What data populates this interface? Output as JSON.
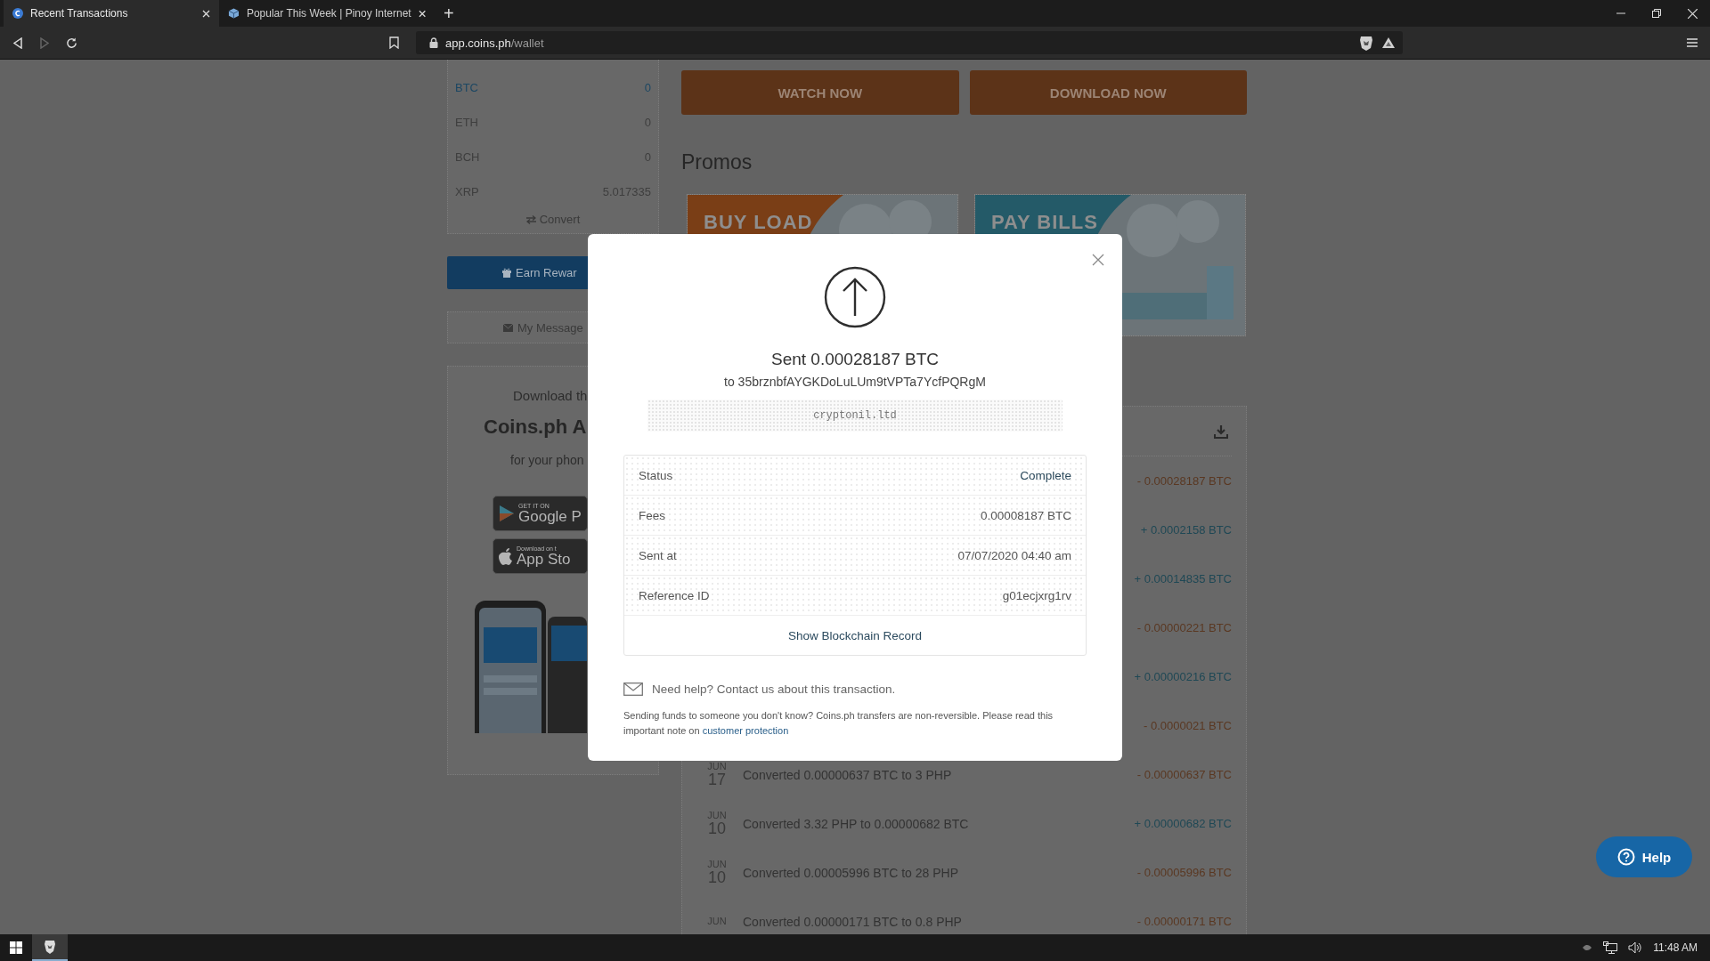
{
  "browser": {
    "tabs": [
      {
        "title": "Recent Transactions",
        "selected": true
      },
      {
        "title": "Popular This Week | Pinoy Internet",
        "selected": false
      }
    ],
    "new_tab": "+",
    "address": {
      "host": "app.coins.ph",
      "path": "/wallet"
    }
  },
  "sidebar": {
    "coins": [
      {
        "symbol": "BTC",
        "balance": "0",
        "selected": true
      },
      {
        "symbol": "ETH",
        "balance": "0",
        "selected": false
      },
      {
        "symbol": "BCH",
        "balance": "0",
        "selected": false
      },
      {
        "symbol": "XRP",
        "balance": "5.017335",
        "selected": false
      }
    ],
    "convert": "Convert",
    "earn_button": "Earn Rewar",
    "messages_button": "My Message",
    "download_card": {
      "intro": "Download th",
      "title": "Coins.ph A",
      "subtitle": "for your phon",
      "badges": [
        {
          "kind": "google",
          "small": "GET IT ON",
          "large": "Google P"
        },
        {
          "kind": "apple",
          "small": "Download on t",
          "large": "App Sto"
        }
      ]
    }
  },
  "main": {
    "action_buttons": [
      "WATCH NOW",
      "DOWNLOAD NOW"
    ],
    "promos_heading": "Promos",
    "promos": [
      {
        "kind": "load",
        "label": "BUY LOAD"
      },
      {
        "kind": "bills",
        "label": "PAY BILLS"
      }
    ],
    "transactions": [
      {
        "kind": "debit",
        "amount": "- 0.00028187 BTC"
      },
      {
        "kind": "credit",
        "amount": "+ 0.0002158 BTC"
      },
      {
        "kind": "credit",
        "amount": "+ 0.00014835 BTC"
      },
      {
        "kind": "debit",
        "amount": "- 0.00000221 BTC"
      },
      {
        "kind": "credit",
        "amount": "+ 0.00000216 BTC"
      },
      {
        "kind": "debit",
        "amount": "- 0.0000021 BTC"
      },
      {
        "kind": "debit",
        "month": "JUN",
        "day": "17",
        "description": "Converted 0.00000637 BTC to 3 PHP",
        "amount": "- 0.00000637 BTC"
      },
      {
        "kind": "credit",
        "month": "JUN",
        "day": "10",
        "description": "Converted 3.32 PHP to 0.00000682 BTC",
        "amount": "+ 0.00000682 BTC"
      },
      {
        "kind": "debit",
        "month": "JUN",
        "day": "10",
        "description": "Converted 0.00005996 BTC to 28 PHP",
        "amount": "- 0.00005996 BTC"
      },
      {
        "kind": "debit",
        "month": "JUN",
        "description": "Converted 0.00000171 BTC to 0.8 PHP",
        "amount": "- 0.00000171 BTC"
      }
    ]
  },
  "modal": {
    "title": "Sent 0.00028187 BTC",
    "recipient": "to 35brznbfAYGKDoLuLUm9tVPTa7YcfPQRgM",
    "memo": "cryptonil.ltd",
    "details": [
      {
        "kind": "status",
        "label": "Status",
        "value": "Complete"
      },
      {
        "kind": "plain",
        "label": "Fees",
        "value": "0.00008187 BTC"
      },
      {
        "kind": "plain",
        "label": "Sent at",
        "value": "07/07/2020 04:40 am"
      },
      {
        "kind": "plain",
        "label": "Reference ID",
        "value": "g01ecjxrg1rv"
      }
    ],
    "blockchain_link": "Show Blockchain Record",
    "help": "Need help? Contact us about this transaction.",
    "note": "Sending funds to someone you don't know? Coins.ph transfers are non-reversible. Please read this important note on",
    "note_link": "customer protection"
  },
  "help_button": "Help",
  "taskbar": {
    "clock": "11:48 AM"
  }
}
